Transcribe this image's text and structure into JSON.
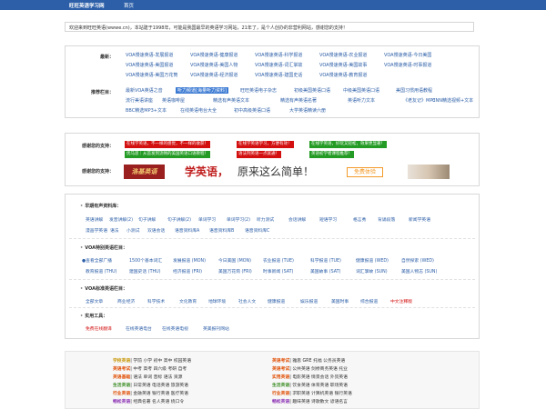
{
  "topbar": {
    "logo": "旺旺英语学习网",
    "home": "首页"
  },
  "welcome": "欢迎来到旺旺英语(wwwe.cn)，本站建于1998年，可能是我国最早的英语学习网站，21年了，是个人创办的非营利网站，感谢您的支持！",
  "nav": {
    "latest_label": "最新：",
    "latest": [
      [
        "VOA慢速英语-发展报道",
        "VOA慢速英语-健康报道",
        "VOA慢速英语-科学报道",
        "VOA慢速英语-农业报道",
        "VOA慢速英语-今日美国"
      ],
      [
        "VOA慢速英语-美国报道",
        "VOA慢速英语-美国人物",
        "VOA慢速英语-词汇掌故",
        "VOA慢速英语-美国故事",
        "VOA慢速英语-时事报道"
      ],
      [
        "VOA慢速英语-美国万花筒",
        "VOA慢速英语-经济报道",
        "VOA慢速英语-建国史话",
        "VOA慢速英语-教育报道"
      ]
    ],
    "recommend_label": "推荐栏目：",
    "recommend": [
      [
        "最新VOA英语之音",
        "听力频道[海量听力资料]",
        "旺旺英语电子杂志",
        "初级美国英语口语",
        "中级美国英语口语",
        "美国习惯用语教程"
      ],
      [
        "流行美语讲座",
        "英语咖啡屋",
        "精选有声英语文本",
        "精选有声英语名著",
        "英语听力文本",
        "《老友记》MP3",
        "CNN精选视频+文本"
      ],
      [
        "BBC精选MP3+文本",
        "在线英语电台大全",
        "初中高级英语口语",
        "大学英语精读六册"
      ]
    ]
  },
  "support": {
    "label": "感谢您的支持：",
    "label2": "感谢您的支持：",
    "tags": [
      "在线学英语，不一样的感觉，不一样的收获！",
      "在线学英语学习，方便有效！",
      "在线学英语，好玩又轻松，效果更显著！",
      "优马思｜从首发到流畅的美国英语口语教程！",
      "语法列英语一点就通！",
      "英语初学者课程推荐！"
    ]
  },
  "ad": {
    "brand": "洛基英语",
    "head1": "学英语，",
    "head2": "原来这么简单！",
    "btn": "免费体验"
  },
  "resources": {
    "s1": "早期有声资料库：",
    "s1_links": [
      [
        "英语讲解",
        "发音讲解(2)",
        "句子讲解",
        "句子讲解(2)",
        "单词学习",
        "单词学习(2)",
        "听力测试",
        "会话讲解",
        "短语学习",
        "格言秀",
        "背诵段落",
        "新闻学英语"
      ],
      [
        "漫画学英语",
        "语法",
        "小测试",
        "双语会话",
        "语音资料库A",
        "语音资料库B",
        "语音资料库C"
      ]
    ],
    "s2": "VOA特别英语栏目：",
    "s2_links": [
      [
        "●查看全部广播",
        "1500个基本词汇",
        "发展报道 (MON)",
        "今日美国 (MON)",
        "农业报道 (TUE)",
        "科学报道 (TUE)",
        "健康报道 (WED)",
        "自然探索 (WED)"
      ],
      [
        "教育报道 (THU)",
        "建国史话 (THU)",
        "经济报道 (FRI)",
        "美国万花筒 (FRI)",
        "时事新闻 (SAT)",
        "美国故事 (SAT)",
        "词汇掌故 (SUN)",
        "美国人物志 (SUN)"
      ]
    ],
    "s3": "VOA标准英语栏目：",
    "s3_links": [
      "全部文章",
      "商业经济",
      "科学技术",
      "文化教育",
      "地球环境",
      "社会人文",
      "健康报道",
      "娱乐报道",
      "美国时事",
      "综合报道",
      "中文注释版"
    ],
    "s4": "实用工具：",
    "s4_links": [
      "免费在线翻译",
      "在线英语电台",
      "在线英语电视",
      "英美报刊网站"
    ]
  },
  "footer": {
    "left": [
      {
        "cat": "学校英语",
        "items": "| 学前  小学  初中  高中  校园英语",
        "color": "y"
      },
      {
        "cat": "英语考试",
        "items": "| 中考  高考  四六级  考研  自考",
        "color": "o"
      },
      {
        "cat": "英语基础",
        "items": "| 语法  单词  音标  语法  资源",
        "color": "o"
      },
      {
        "cat": "生活英语",
        "items": "| 日常英语  电话英语  旅游英语",
        "color": "g"
      },
      {
        "cat": "行业英语",
        "items": "| 金融英语  银行英语  医疗英语",
        "color": "o"
      },
      {
        "cat": "畅松英语",
        "items": "| 经典名著  名人英语  绕口令",
        "color": "p"
      }
    ],
    "right": [
      {
        "cat": "英语考试",
        "items": "| 雅思  GRE  托福  公务员英语",
        "color": "o"
      },
      {
        "cat": "英语考试",
        "items": "| 公共英语  剑桥商务英语  托业",
        "color": "o"
      },
      {
        "cat": "实用英语",
        "items": "| 电影英语  情景会话  外贸英语",
        "color": "o"
      },
      {
        "cat": "生活英语",
        "items": "| 饮食英语  体育英语  职场英语",
        "color": "g"
      },
      {
        "cat": "行业英语",
        "items": "| 求职英语  计算机英语  银行英语",
        "color": "o"
      },
      {
        "cat": "畅松英语",
        "items": "| 趣味英语  诗歌散文  谚语名言",
        "color": "p"
      }
    ]
  }
}
